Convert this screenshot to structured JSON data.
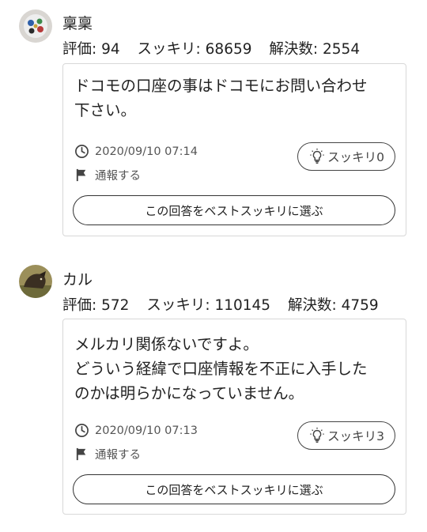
{
  "answers": [
    {
      "username": "稟稟",
      "stats": {
        "rating": "評価: 94",
        "sukkiri": "スッキリ: 68659",
        "resolved": "解決数: 2554"
      },
      "body_lines": [
        "ドコモの口座の事はドコモにお問い合わせ",
        "下さい。"
      ],
      "timestamp": "2020/09/10 07:14",
      "report_label": "通報する",
      "sukkiri_button": "スッキリ0",
      "best_button": "この回答をベストスッキリに選ぶ",
      "icons": {
        "avatar": "avatar-image",
        "clock": "clock-icon",
        "flag": "flag-icon",
        "bulb": "lightbulb-icon"
      }
    },
    {
      "username": "カル",
      "stats": {
        "rating": "評価: 572",
        "sukkiri": "スッキリ: 110145",
        "resolved": "解決数: 4759"
      },
      "body_lines": [
        "メルカリ関係ないですよ。",
        "どういう経緯で口座情報を不正に入手した",
        "のかは明らかになっていません。"
      ],
      "timestamp": "2020/09/10 07:13",
      "report_label": "通報する",
      "sukkiri_button": "スッキリ3",
      "best_button": "この回答をベストスッキリに選ぶ",
      "icons": {
        "avatar": "avatar-image",
        "clock": "clock-icon",
        "flag": "flag-icon",
        "bulb": "lightbulb-icon"
      }
    }
  ]
}
